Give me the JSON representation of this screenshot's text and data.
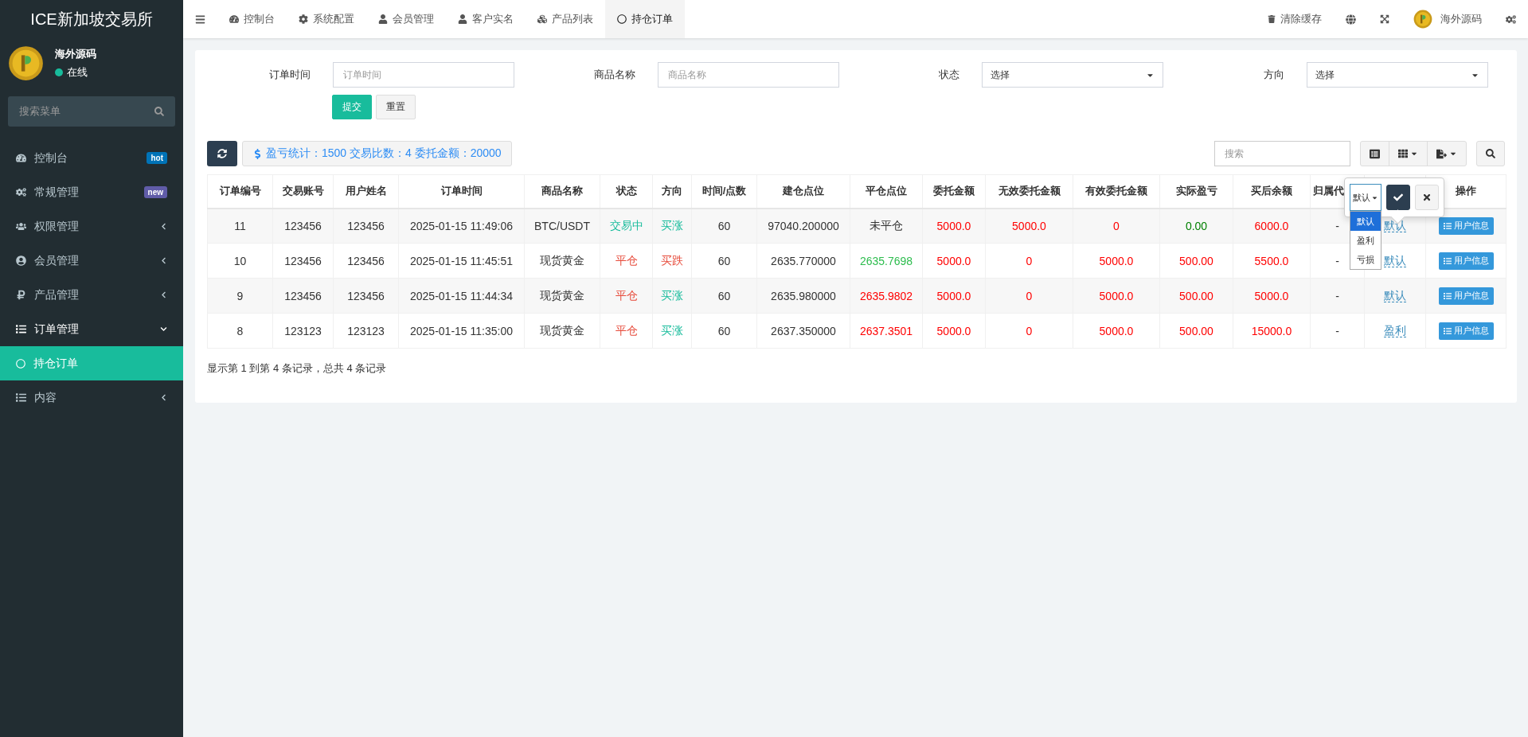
{
  "brand": "ICE新加坡交易所",
  "user": {
    "name": "海外源码",
    "status": "在线"
  },
  "sidebar_search": {
    "placeholder": "搜索菜单"
  },
  "sidebar": {
    "items": [
      {
        "kind": "link",
        "label": "控制台",
        "badge": {
          "text": "hot",
          "color": "#0073b7"
        },
        "selected": false
      },
      {
        "kind": "link",
        "label": "常规管理",
        "badge": {
          "text": "new",
          "color": "#605ca8"
        },
        "selected": false
      },
      {
        "kind": "folder",
        "label": "权限管理",
        "expanded": false
      },
      {
        "kind": "folder",
        "label": "会员管理",
        "expanded": false
      },
      {
        "kind": "folder",
        "label": "产品管理",
        "expanded": false
      },
      {
        "kind": "folder",
        "label": "订单管理",
        "expanded": true,
        "children": [
          {
            "label": "持仓订单",
            "selected": true
          }
        ]
      },
      {
        "kind": "folder",
        "label": "内容",
        "expanded": false
      }
    ]
  },
  "tabs": [
    {
      "label": "控制台",
      "selected": false
    },
    {
      "label": "系统配置",
      "selected": false
    },
    {
      "label": "会员管理",
      "selected": false
    },
    {
      "label": "客户实名",
      "selected": false
    },
    {
      "label": "产品列表",
      "selected": false
    },
    {
      "label": "持仓订单",
      "selected": true
    }
  ],
  "topbar": {
    "clear_cache": "清除缓存",
    "user_name": "海外源码"
  },
  "filters": [
    {
      "kind": "input",
      "label": "订单时间",
      "placeholder": "订单时间"
    },
    {
      "kind": "input",
      "label": "商品名称",
      "placeholder": "商品名称"
    },
    {
      "kind": "select",
      "label": "状态",
      "value": "选择"
    },
    {
      "kind": "select",
      "label": "方向",
      "value": "选择"
    }
  ],
  "filter_buttons": {
    "submit": "提交",
    "reset": "重置"
  },
  "stats": "盈亏统计：1500 交易比数：4 委托金额：20000",
  "table_search": {
    "placeholder": "搜索"
  },
  "columns": [
    "订单编号",
    "交易账号",
    "用户姓名",
    "订单时间",
    "商品名称",
    "状态",
    "方向",
    "时间/点数",
    "建仓点位",
    "平仓点位",
    "委托金额",
    "无效委托金额",
    "有效委托金额",
    "实际盈亏",
    "买后余额",
    "归属代",
    "",
    "操作"
  ],
  "rows": [
    {
      "cells": [
        {
          "text": "11"
        },
        {
          "text": "123456"
        },
        {
          "text": "123456"
        },
        {
          "text": "2025-01-15 11:49:06"
        },
        {
          "text": "BTC/USDT"
        },
        {
          "text": "交易中",
          "color": "#18bc9c"
        },
        {
          "text": "买涨",
          "color": "#18bc9c"
        },
        {
          "text": "60"
        },
        {
          "text": "97040.200000"
        },
        {
          "text": "未平仓"
        },
        {
          "text": "5000.0",
          "color": "#ff0000"
        },
        {
          "text": "5000.0",
          "color": "#ff0000"
        },
        {
          "text": "0",
          "color": "#ff0000"
        },
        {
          "text": "0.00",
          "color": "#008000"
        },
        {
          "text": "6000.0",
          "color": "#ff0000"
        },
        {
          "text": "-"
        }
      ],
      "settle": "默认",
      "action": "用户信息"
    },
    {
      "cells": [
        {
          "text": "10"
        },
        {
          "text": "123456"
        },
        {
          "text": "123456"
        },
        {
          "text": "2025-01-15 11:45:51"
        },
        {
          "text": "现货黄金"
        },
        {
          "text": "平仓",
          "color": "#e74c3c"
        },
        {
          "text": "买跌",
          "color": "#e74c3c"
        },
        {
          "text": "60"
        },
        {
          "text": "2635.770000"
        },
        {
          "text": "2635.7698",
          "color": "#2dbd4e"
        },
        {
          "text": "5000.0",
          "color": "#ff0000"
        },
        {
          "text": "0",
          "color": "#ff0000"
        },
        {
          "text": "5000.0",
          "color": "#ff0000"
        },
        {
          "text": "500.00",
          "color": "#ff0000"
        },
        {
          "text": "5500.0",
          "color": "#ff0000"
        },
        {
          "text": "-"
        }
      ],
      "settle": "默认",
      "action": "用户信息"
    },
    {
      "cells": [
        {
          "text": "9"
        },
        {
          "text": "123456"
        },
        {
          "text": "123456"
        },
        {
          "text": "2025-01-15 11:44:34"
        },
        {
          "text": "现货黄金"
        },
        {
          "text": "平仓",
          "color": "#e74c3c"
        },
        {
          "text": "买涨",
          "color": "#18bc9c"
        },
        {
          "text": "60"
        },
        {
          "text": "2635.980000"
        },
        {
          "text": "2635.9802",
          "color": "#ff0000"
        },
        {
          "text": "5000.0",
          "color": "#ff0000"
        },
        {
          "text": "0",
          "color": "#ff0000"
        },
        {
          "text": "5000.0",
          "color": "#ff0000"
        },
        {
          "text": "500.00",
          "color": "#ff0000"
        },
        {
          "text": "5000.0",
          "color": "#ff0000"
        },
        {
          "text": "-"
        }
      ],
      "settle": "默认",
      "action": "用户信息"
    },
    {
      "cells": [
        {
          "text": "8"
        },
        {
          "text": "123123"
        },
        {
          "text": "123123"
        },
        {
          "text": "2025-01-15 11:35:00"
        },
        {
          "text": "现货黄金"
        },
        {
          "text": "平仓",
          "color": "#e74c3c"
        },
        {
          "text": "买涨",
          "color": "#18bc9c"
        },
        {
          "text": "60"
        },
        {
          "text": "2637.350000"
        },
        {
          "text": "2637.3501",
          "color": "#ff0000"
        },
        {
          "text": "5000.0",
          "color": "#ff0000"
        },
        {
          "text": "0",
          "color": "#ff0000"
        },
        {
          "text": "5000.0",
          "color": "#ff0000"
        },
        {
          "text": "500.00",
          "color": "#ff0000"
        },
        {
          "text": "15000.0",
          "color": "#ff0000"
        },
        {
          "text": "-"
        }
      ],
      "settle": "盈利",
      "action": "用户信息"
    }
  ],
  "pagination_info": "显示第 1 到第 4 条记录，总共 4 条记录",
  "edit_popup": {
    "value": "默认",
    "options": [
      {
        "label": "默认",
        "selected": true
      },
      {
        "label": "盈利",
        "selected": false
      },
      {
        "label": "亏损",
        "selected": false
      }
    ]
  }
}
